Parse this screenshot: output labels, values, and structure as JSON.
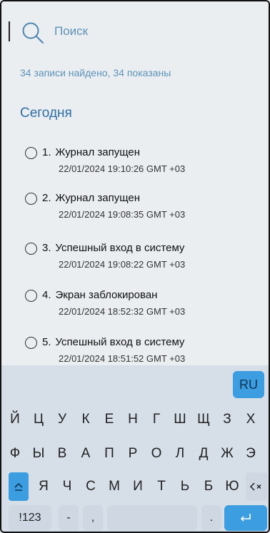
{
  "search": {
    "placeholder": "Поиск"
  },
  "results_summary": "34 записи найдено, 34 показаны",
  "section_title": "Сегодня",
  "items": [
    {
      "num": "1.",
      "title": "Журнал запущен",
      "time": "22/01/2024 19:10:26 GMT +03"
    },
    {
      "num": "2.",
      "title": "Журнал запущен",
      "time": "22/01/2024 19:08:35 GMT +03"
    },
    {
      "num": "3.",
      "title": "Успешный вход в систему",
      "time": "22/01/2024 19:08:22 GMT +03"
    },
    {
      "num": "4.",
      "title": "Экран заблокирован",
      "time": "22/01/2024 18:52:32 GMT +03"
    },
    {
      "num": "5.",
      "title": "Успешный вход в систему",
      "time": "22/01/2024 18:51:52 GMT +03"
    }
  ],
  "keyboard": {
    "lang": "RU",
    "row1": [
      "Й",
      "Ц",
      "У",
      "К",
      "Е",
      "Н",
      "Г",
      "Ш",
      "Щ",
      "З",
      "Х"
    ],
    "row2": [
      "Ф",
      "Ы",
      "В",
      "А",
      "П",
      "Р",
      "О",
      "Л",
      "Д",
      "Ж",
      "Э"
    ],
    "row3": [
      "Я",
      "Ч",
      "С",
      "М",
      "И",
      "Т",
      "Ь",
      "Б",
      "Ю"
    ],
    "sym": "!123",
    "dash": "-",
    "comma": ",",
    "period": ".",
    "accent_color": "#3c9ee0"
  }
}
